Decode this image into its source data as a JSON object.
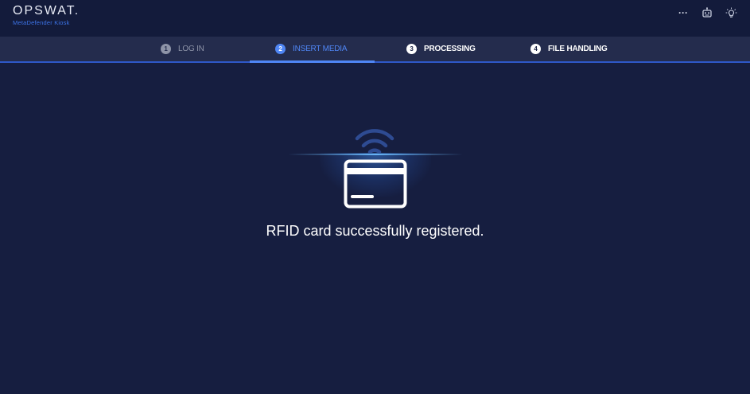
{
  "header": {
    "brand": "OPSWAT.",
    "product": "MetaDefender Kiosk",
    "tools": [
      {
        "icon": "more-dots-icon",
        "label": "···"
      },
      {
        "icon": "robot-icon"
      },
      {
        "icon": "lightbulb-icon"
      }
    ]
  },
  "stepper": {
    "steps": [
      {
        "number": "1",
        "label": "LOG IN",
        "state": "done"
      },
      {
        "number": "2",
        "label": "INSERT MEDIA",
        "state": "active"
      },
      {
        "number": "3",
        "label": "PROCESSING",
        "state": "pending"
      },
      {
        "number": "4",
        "label": "FILE HANDLING",
        "state": "pending"
      }
    ]
  },
  "main": {
    "icon": "rfid-card-icon",
    "message": "RFID card successfully registered."
  },
  "colors": {
    "background": "#161e40",
    "header": "#131b3b",
    "stepper": "#242c4d",
    "accent": "#4f86f5",
    "muted": "#8e94a8",
    "text": "#ffffff"
  }
}
